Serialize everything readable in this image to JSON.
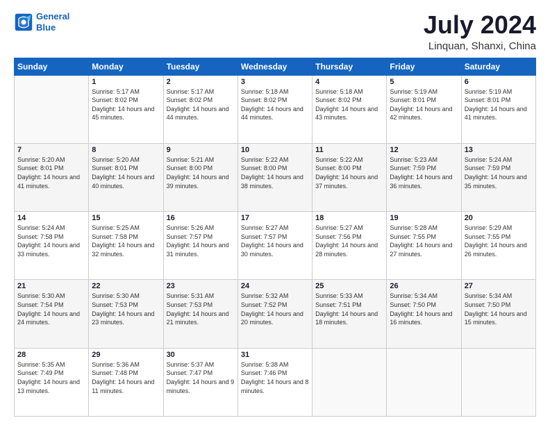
{
  "logo": {
    "line1": "General",
    "line2": "Blue"
  },
  "title": "July 2024",
  "subtitle": "Linquan, Shanxi, China",
  "weekdays": [
    "Sunday",
    "Monday",
    "Tuesday",
    "Wednesday",
    "Thursday",
    "Friday",
    "Saturday"
  ],
  "weeks": [
    [
      {
        "day": "",
        "sunrise": "",
        "sunset": "",
        "daylight": ""
      },
      {
        "day": "1",
        "sunrise": "Sunrise: 5:17 AM",
        "sunset": "Sunset: 8:02 PM",
        "daylight": "Daylight: 14 hours and 45 minutes."
      },
      {
        "day": "2",
        "sunrise": "Sunrise: 5:17 AM",
        "sunset": "Sunset: 8:02 PM",
        "daylight": "Daylight: 14 hours and 44 minutes."
      },
      {
        "day": "3",
        "sunrise": "Sunrise: 5:18 AM",
        "sunset": "Sunset: 8:02 PM",
        "daylight": "Daylight: 14 hours and 44 minutes."
      },
      {
        "day": "4",
        "sunrise": "Sunrise: 5:18 AM",
        "sunset": "Sunset: 8:02 PM",
        "daylight": "Daylight: 14 hours and 43 minutes."
      },
      {
        "day": "5",
        "sunrise": "Sunrise: 5:19 AM",
        "sunset": "Sunset: 8:01 PM",
        "daylight": "Daylight: 14 hours and 42 minutes."
      },
      {
        "day": "6",
        "sunrise": "Sunrise: 5:19 AM",
        "sunset": "Sunset: 8:01 PM",
        "daylight": "Daylight: 14 hours and 41 minutes."
      }
    ],
    [
      {
        "day": "7",
        "sunrise": "Sunrise: 5:20 AM",
        "sunset": "Sunset: 8:01 PM",
        "daylight": "Daylight: 14 hours and 41 minutes."
      },
      {
        "day": "8",
        "sunrise": "Sunrise: 5:20 AM",
        "sunset": "Sunset: 8:01 PM",
        "daylight": "Daylight: 14 hours and 40 minutes."
      },
      {
        "day": "9",
        "sunrise": "Sunrise: 5:21 AM",
        "sunset": "Sunset: 8:00 PM",
        "daylight": "Daylight: 14 hours and 39 minutes."
      },
      {
        "day": "10",
        "sunrise": "Sunrise: 5:22 AM",
        "sunset": "Sunset: 8:00 PM",
        "daylight": "Daylight: 14 hours and 38 minutes."
      },
      {
        "day": "11",
        "sunrise": "Sunrise: 5:22 AM",
        "sunset": "Sunset: 8:00 PM",
        "daylight": "Daylight: 14 hours and 37 minutes."
      },
      {
        "day": "12",
        "sunrise": "Sunrise: 5:23 AM",
        "sunset": "Sunset: 7:59 PM",
        "daylight": "Daylight: 14 hours and 36 minutes."
      },
      {
        "day": "13",
        "sunrise": "Sunrise: 5:24 AM",
        "sunset": "Sunset: 7:59 PM",
        "daylight": "Daylight: 14 hours and 35 minutes."
      }
    ],
    [
      {
        "day": "14",
        "sunrise": "Sunrise: 5:24 AM",
        "sunset": "Sunset: 7:58 PM",
        "daylight": "Daylight: 14 hours and 33 minutes."
      },
      {
        "day": "15",
        "sunrise": "Sunrise: 5:25 AM",
        "sunset": "Sunset: 7:58 PM",
        "daylight": "Daylight: 14 hours and 32 minutes."
      },
      {
        "day": "16",
        "sunrise": "Sunrise: 5:26 AM",
        "sunset": "Sunset: 7:57 PM",
        "daylight": "Daylight: 14 hours and 31 minutes."
      },
      {
        "day": "17",
        "sunrise": "Sunrise: 5:27 AM",
        "sunset": "Sunset: 7:57 PM",
        "daylight": "Daylight: 14 hours and 30 minutes."
      },
      {
        "day": "18",
        "sunrise": "Sunrise: 5:27 AM",
        "sunset": "Sunset: 7:56 PM",
        "daylight": "Daylight: 14 hours and 28 minutes."
      },
      {
        "day": "19",
        "sunrise": "Sunrise: 5:28 AM",
        "sunset": "Sunset: 7:55 PM",
        "daylight": "Daylight: 14 hours and 27 minutes."
      },
      {
        "day": "20",
        "sunrise": "Sunrise: 5:29 AM",
        "sunset": "Sunset: 7:55 PM",
        "daylight": "Daylight: 14 hours and 26 minutes."
      }
    ],
    [
      {
        "day": "21",
        "sunrise": "Sunrise: 5:30 AM",
        "sunset": "Sunset: 7:54 PM",
        "daylight": "Daylight: 14 hours and 24 minutes."
      },
      {
        "day": "22",
        "sunrise": "Sunrise: 5:30 AM",
        "sunset": "Sunset: 7:53 PM",
        "daylight": "Daylight: 14 hours and 23 minutes."
      },
      {
        "day": "23",
        "sunrise": "Sunrise: 5:31 AM",
        "sunset": "Sunset: 7:53 PM",
        "daylight": "Daylight: 14 hours and 21 minutes."
      },
      {
        "day": "24",
        "sunrise": "Sunrise: 5:32 AM",
        "sunset": "Sunset: 7:52 PM",
        "daylight": "Daylight: 14 hours and 20 minutes."
      },
      {
        "day": "25",
        "sunrise": "Sunrise: 5:33 AM",
        "sunset": "Sunset: 7:51 PM",
        "daylight": "Daylight: 14 hours and 18 minutes."
      },
      {
        "day": "26",
        "sunrise": "Sunrise: 5:34 AM",
        "sunset": "Sunset: 7:50 PM",
        "daylight": "Daylight: 14 hours and 16 minutes."
      },
      {
        "day": "27",
        "sunrise": "Sunrise: 5:34 AM",
        "sunset": "Sunset: 7:50 PM",
        "daylight": "Daylight: 14 hours and 15 minutes."
      }
    ],
    [
      {
        "day": "28",
        "sunrise": "Sunrise: 5:35 AM",
        "sunset": "Sunset: 7:49 PM",
        "daylight": "Daylight: 14 hours and 13 minutes."
      },
      {
        "day": "29",
        "sunrise": "Sunrise: 5:36 AM",
        "sunset": "Sunset: 7:48 PM",
        "daylight": "Daylight: 14 hours and 11 minutes."
      },
      {
        "day": "30",
        "sunrise": "Sunrise: 5:37 AM",
        "sunset": "Sunset: 7:47 PM",
        "daylight": "Daylight: 14 hours and 9 minutes."
      },
      {
        "day": "31",
        "sunrise": "Sunrise: 5:38 AM",
        "sunset": "Sunset: 7:46 PM",
        "daylight": "Daylight: 14 hours and 8 minutes."
      },
      {
        "day": "",
        "sunrise": "",
        "sunset": "",
        "daylight": ""
      },
      {
        "day": "",
        "sunrise": "",
        "sunset": "",
        "daylight": ""
      },
      {
        "day": "",
        "sunrise": "",
        "sunset": "",
        "daylight": ""
      }
    ]
  ]
}
